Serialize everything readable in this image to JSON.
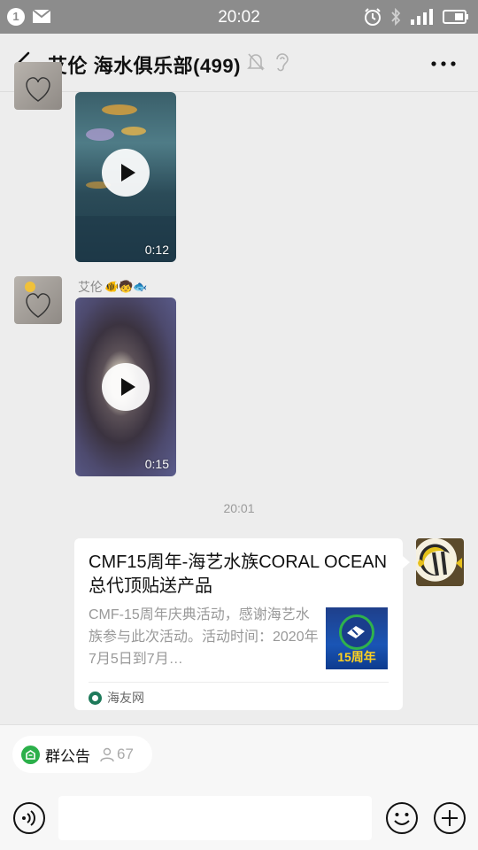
{
  "status_bar": {
    "notification_count": "1",
    "time": "20:02",
    "icons": [
      "mail-icon",
      "alarm-icon",
      "bluetooth-icon",
      "signal-4g-icon",
      "battery-icon"
    ]
  },
  "header": {
    "title": "艾伦 海水俱乐部(499)",
    "icons": [
      "back-icon",
      "mute-bell-icon",
      "earpiece-icon",
      "more-icon"
    ]
  },
  "messages": [
    {
      "type": "video",
      "duration": "0:12"
    },
    {
      "type": "video",
      "sender": "艾伦",
      "sender_emojis": "🐠🧒🐟",
      "duration": "0:15"
    },
    {
      "type": "timestamp",
      "text": "20:01"
    },
    {
      "type": "link",
      "title": "CMF15周年-海艺水族CORAL OCEAN总代顶贴送产品",
      "description": "CMF-15周年庆典活动，感谢海艺水族参与此次活动。活动时间：2020年7月5日到7月…",
      "thumbnail_text": "15周年",
      "source": "海友网"
    }
  ],
  "footer": {
    "announcement_label": "群公告",
    "member_count": "67",
    "icons": [
      "voice-icon",
      "emoji-icon",
      "plus-icon"
    ]
  }
}
